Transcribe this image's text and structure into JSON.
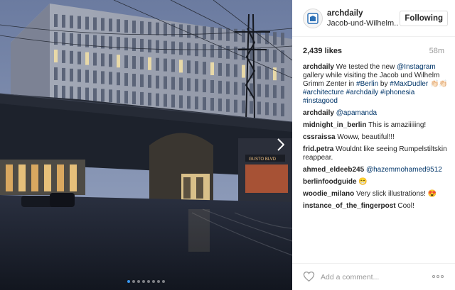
{
  "post": {
    "username": "archdaily",
    "location": "Jacob-und-Wilhelm..",
    "follow_label": "Following",
    "likes": "2,439 likes",
    "time": "58m",
    "caption": {
      "user": "archdaily",
      "t1": " We tested the new ",
      "m1": "@Instagram",
      "t2": " gallery while visiting the Jacob und Wilhelm Grimm Zenter in ",
      "h1": "#Berlin",
      "t3": " by ",
      "h2": "#MaxDudler",
      "t4": " 👏🏻👏🏻 ",
      "h3": "#architecture",
      "h4": "#archdaily",
      "h5": "#iphonesia",
      "h6": "#instagood"
    },
    "comments": [
      {
        "user": "archdaily",
        "text": "",
        "mention": "@apamanda"
      },
      {
        "user": "midnight_in_berlin",
        "text": "This is amaziiiiing!"
      },
      {
        "user": "cssraissa",
        "text": "Woww, beautiful!!!"
      },
      {
        "user": "frid.petra",
        "text": "Wouldnt like seeing Rumpelstiltskin reappear."
      },
      {
        "user": "ahmed_eldeeb245",
        "text": "",
        "mention": "@hazemmohamed9512"
      },
      {
        "user": "berlinfoodguide",
        "text": "😁"
      },
      {
        "user": "woodie_milano",
        "text": "Very slick illustrations! 😍"
      },
      {
        "user": "instance_of_the_fingerpost",
        "text": "Cool!"
      }
    ],
    "add_comment_placeholder": "Add a comment...",
    "carousel": {
      "count": 8,
      "active_index": 0
    }
  },
  "colors": {
    "link": "#003569",
    "accent": "#3897f0",
    "muted": "#999999",
    "border": "#efefef"
  },
  "icons": {
    "avatar": "archdaily-logo-icon",
    "like": "heart-icon",
    "more": "more-options-icon",
    "next": "chevron-right-icon"
  }
}
